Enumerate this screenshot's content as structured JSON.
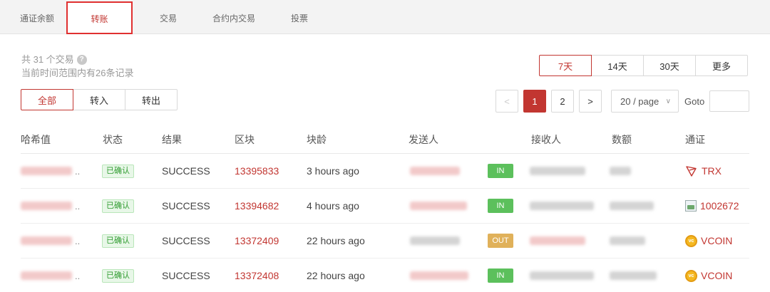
{
  "tabs": [
    {
      "label": "通证余额"
    },
    {
      "label": "转账"
    },
    {
      "label": "交易"
    },
    {
      "label": "合约内交易"
    },
    {
      "label": "投票"
    }
  ],
  "active_tab": "转账",
  "summary": {
    "count_text": "共 31 个交易",
    "range_text": "当前时间范围内有26条记录",
    "help_icon": "?"
  },
  "range_options": [
    "7天",
    "14天",
    "30天",
    "更多"
  ],
  "active_range": "7天",
  "filter_options": [
    "全部",
    "转入",
    "转出"
  ],
  "active_filter": "全部",
  "pagination": {
    "prev": "<",
    "pages": [
      "1",
      "2"
    ],
    "current_page": "1",
    "next": ">",
    "page_size": "20 / page",
    "goto_label": "Goto",
    "goto_value": ""
  },
  "table": {
    "headers": [
      "哈希值",
      "状态",
      "结果",
      "区块",
      "块龄",
      "发送人",
      "接收人",
      "数额",
      "通证"
    ],
    "rows": [
      {
        "hash": "..",
        "status": "已确认",
        "result": "SUCCESS",
        "block": "13395833",
        "age": "3 hours ago",
        "direction": "IN",
        "token": "TRX",
        "token_icon": "tron-icon"
      },
      {
        "hash": "..",
        "status": "已确认",
        "result": "SUCCESS",
        "block": "13394682",
        "age": "4 hours ago",
        "direction": "IN",
        "token": "1002672",
        "token_icon": "broken-image-icon"
      },
      {
        "hash": "..",
        "status": "已确认",
        "result": "SUCCESS",
        "block": "13372409",
        "age": "22 hours ago",
        "direction": "OUT",
        "token": "VCOIN",
        "token_icon": "vcoin-icon"
      },
      {
        "hash": "..",
        "status": "已确认",
        "result": "SUCCESS",
        "block": "13372408",
        "age": "22 hours ago",
        "direction": "IN",
        "token": "VCOIN",
        "token_icon": "vcoin-icon"
      }
    ]
  },
  "colors": {
    "accent": "#c23631",
    "in_badge": "#5cc05c",
    "out_badge": "#e0b15a",
    "confirmed_badge_text": "#2e9b2e"
  }
}
